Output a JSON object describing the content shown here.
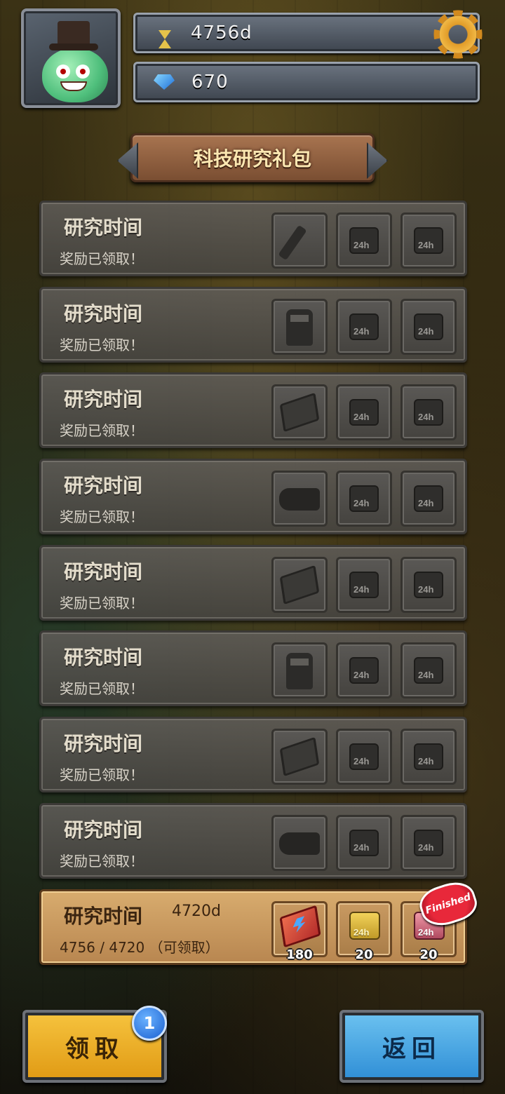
{
  "header": {
    "time_value": "4756d",
    "gem_value": "670"
  },
  "title": "科技研究礼包",
  "rows": [
    {
      "label": "研究时间",
      "status": "奖励已领取！"
    },
    {
      "label": "研究时间",
      "status": "奖励已领取！"
    },
    {
      "label": "研究时间",
      "status": "奖励已领取！"
    },
    {
      "label": "研究时间",
      "status": "奖励已领取！"
    },
    {
      "label": "研究时间",
      "status": "奖励已领取！"
    },
    {
      "label": "研究时间",
      "status": "奖励已领取！"
    },
    {
      "label": "研究时间",
      "status": "奖励已领取！"
    },
    {
      "label": "研究时间",
      "status": "奖励已领取！"
    }
  ],
  "active_row": {
    "label": "研究时间",
    "days": "4720d",
    "progress_text": "4756 / 4720 （可领取）",
    "item1_qty": "180",
    "item2_qty": "20",
    "item3_qty": "20",
    "finished_label": "Finished"
  },
  "buttons": {
    "claim_label": "领取",
    "claim_badge": "1",
    "back_label": "返回"
  }
}
